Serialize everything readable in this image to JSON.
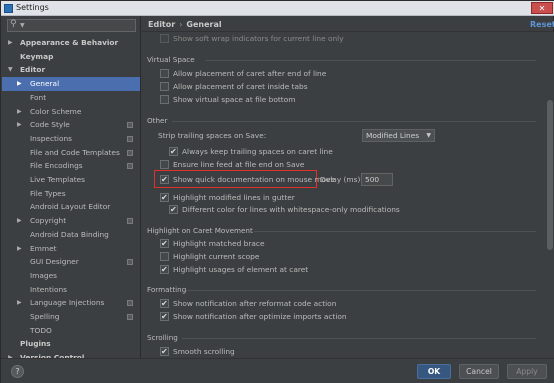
{
  "window": {
    "title": "Settings",
    "close_glyph": "✕"
  },
  "sidebar": {
    "search": {
      "icon": "search-icon",
      "value": ""
    },
    "items": [
      {
        "label": "Appearance & Behavior",
        "bold": true,
        "arrow": "▶",
        "indent": 0
      },
      {
        "label": "Keymap",
        "bold": true,
        "arrow": "",
        "indent": 0
      },
      {
        "label": "Editor",
        "bold": true,
        "arrow": "▼",
        "indent": 0
      },
      {
        "label": "General",
        "bold": false,
        "arrow": "▶",
        "indent": 1,
        "selected": true
      },
      {
        "label": "Font",
        "bold": false,
        "arrow": "",
        "indent": 1
      },
      {
        "label": "Color Scheme",
        "bold": false,
        "arrow": "▶",
        "indent": 1
      },
      {
        "label": "Code Style",
        "bold": false,
        "arrow": "▶",
        "indent": 1,
        "project": true
      },
      {
        "label": "Inspections",
        "bold": false,
        "arrow": "",
        "indent": 1,
        "project": true
      },
      {
        "label": "File and Code Templates",
        "bold": false,
        "arrow": "",
        "indent": 1,
        "project": true
      },
      {
        "label": "File Encodings",
        "bold": false,
        "arrow": "",
        "indent": 1,
        "project": true
      },
      {
        "label": "Live Templates",
        "bold": false,
        "arrow": "",
        "indent": 1
      },
      {
        "label": "File Types",
        "bold": false,
        "arrow": "",
        "indent": 1
      },
      {
        "label": "Android Layout Editor",
        "bold": false,
        "arrow": "",
        "indent": 1
      },
      {
        "label": "Copyright",
        "bold": false,
        "arrow": "▶",
        "indent": 1,
        "project": true
      },
      {
        "label": "Android Data Binding",
        "bold": false,
        "arrow": "",
        "indent": 1
      },
      {
        "label": "Emmet",
        "bold": false,
        "arrow": "▶",
        "indent": 1
      },
      {
        "label": "GUI Designer",
        "bold": false,
        "arrow": "",
        "indent": 1,
        "project": true
      },
      {
        "label": "Images",
        "bold": false,
        "arrow": "",
        "indent": 1
      },
      {
        "label": "Intentions",
        "bold": false,
        "arrow": "",
        "indent": 1
      },
      {
        "label": "Language Injections",
        "bold": false,
        "arrow": "▶",
        "indent": 1,
        "project": true
      },
      {
        "label": "Spelling",
        "bold": false,
        "arrow": "",
        "indent": 1,
        "project": true
      },
      {
        "label": "TODO",
        "bold": false,
        "arrow": "",
        "indent": 1
      },
      {
        "label": "Plugins",
        "bold": true,
        "arrow": "",
        "indent": 0
      },
      {
        "label": "Version Control",
        "bold": true,
        "arrow": "▶",
        "indent": 0
      }
    ]
  },
  "header": {
    "crumb_parent": "Editor",
    "crumb_sep": "›",
    "crumb_current": "General",
    "reset_label": "Reset"
  },
  "content": {
    "top_option": {
      "label": "Show soft wrap indicators for current line only",
      "checked": false,
      "disabled": true
    },
    "virtual_space": {
      "title": "Virtual Space",
      "options": [
        {
          "label": "Allow placement of caret after end of line",
          "checked": false
        },
        {
          "label": "Allow placement of caret inside tabs",
          "checked": false
        },
        {
          "label": "Show virtual space at file bottom",
          "checked": false
        }
      ]
    },
    "other": {
      "title": "Other",
      "strip_label": "Strip trailing spaces on Save:",
      "strip_value": "Modified Lines",
      "always_keep": {
        "label": "Always keep trailing spaces on caret line",
        "checked": true
      },
      "ensure_lf": {
        "label": "Ensure line feed at file end on Save",
        "checked": false
      },
      "show_quick_doc": {
        "label": "Show quick documentation on mouse move",
        "checked": true
      },
      "delay_label": "Delay (ms):",
      "delay_value": "500",
      "highlight_modified": {
        "label": "Highlight modified lines in gutter",
        "checked": true
      },
      "different_color": {
        "label": "Different color for lines with whitespace-only modifications",
        "checked": true
      }
    },
    "caret_movement": {
      "title": "Highlight on Caret Movement",
      "options": [
        {
          "label": "Highlight matched brace",
          "checked": true
        },
        {
          "label": "Highlight current scope",
          "checked": false
        },
        {
          "label": "Highlight usages of element at caret",
          "checked": true
        }
      ]
    },
    "formatting": {
      "title": "Formatting",
      "options": [
        {
          "label": "Show notification after reformat code action",
          "checked": true
        },
        {
          "label": "Show notification after optimize imports action",
          "checked": true
        }
      ]
    },
    "scrolling": {
      "title": "Scrolling",
      "options": [
        {
          "label": "Smooth scrolling",
          "checked": true
        }
      ]
    }
  },
  "footer": {
    "help_label": "?",
    "ok_label": "OK",
    "cancel_label": "Cancel",
    "apply_label": "Apply"
  },
  "colors": {
    "selection": "#4b6eaf",
    "highlight_box": "#e0312a",
    "link": "#5e94d7"
  }
}
